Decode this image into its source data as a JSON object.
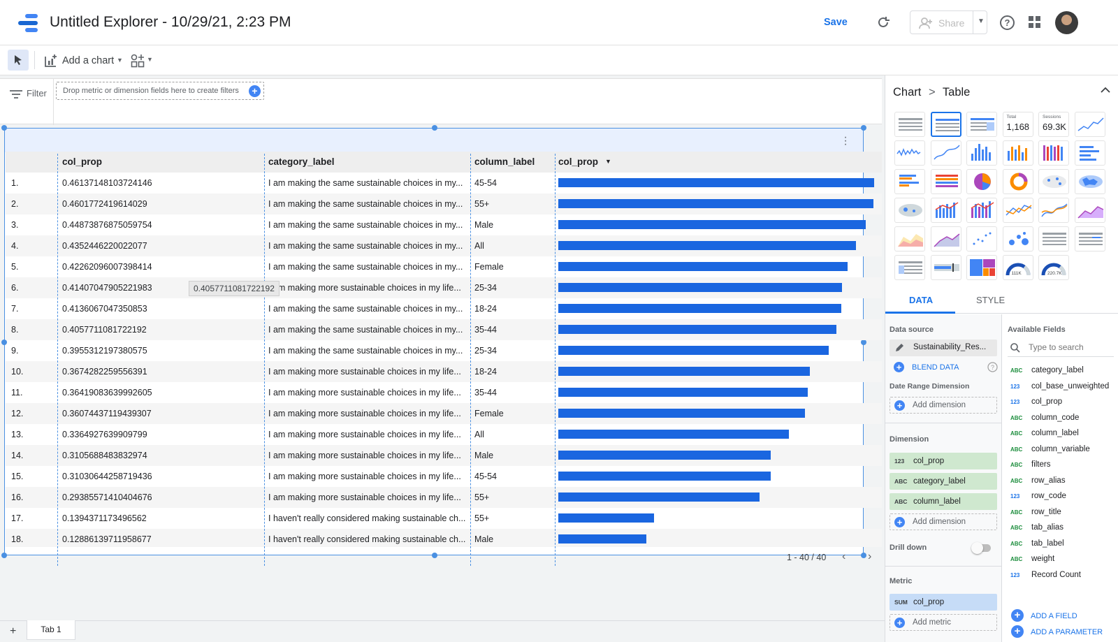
{
  "header": {
    "title": "Untitled Explorer - 10/29/21, 2:23 PM",
    "save_label": "Save",
    "share_label": "Share"
  },
  "toolbar": {
    "add_chart_label": "Add a chart"
  },
  "filter_bar": {
    "label": "Filter",
    "drop_hint": "Drop metric or dimension fields here to create filters"
  },
  "table": {
    "headers": [
      "col_prop",
      "category_label",
      "column_label",
      "col_prop"
    ],
    "sort_indicator": "▼",
    "rows": [
      {
        "n": "1.",
        "col_prop": "0.46137148103724146",
        "category_label": "I am making the same sustainable choices in my...",
        "column_label": "45-54",
        "bar": 0.46137148103724146
      },
      {
        "n": "2.",
        "col_prop": "0.4601772419614029",
        "category_label": "I am making the same sustainable choices in my...",
        "column_label": "55+",
        "bar": 0.4601772419614029
      },
      {
        "n": "3.",
        "col_prop": "0.44873876875059754",
        "category_label": "I am making the same sustainable choices in my...",
        "column_label": "Male",
        "bar": 0.44873876875059754
      },
      {
        "n": "4.",
        "col_prop": "0.4352446220022077",
        "category_label": "I am making the same sustainable choices in my...",
        "column_label": "All",
        "bar": 0.4352446220022077
      },
      {
        "n": "5.",
        "col_prop": "0.42262096007398414",
        "category_label": "I am making the same sustainable choices in my...",
        "column_label": "Female",
        "bar": 0.42262096007398414
      },
      {
        "n": "6.",
        "col_prop": "0.41407047905221983",
        "category_label": "I am making more sustainable choices in my life...",
        "column_label": "25-34",
        "bar": 0.41407047905221983
      },
      {
        "n": "7.",
        "col_prop": "0.4136067047350853",
        "category_label": "I am making the same sustainable choices in my...",
        "column_label": "18-24",
        "bar": 0.4136067047350853
      },
      {
        "n": "8.",
        "col_prop": "0.4057711081722192",
        "category_label": "I am making the same sustainable choices in my...",
        "column_label": "35-44",
        "bar": 0.4057711081722192
      },
      {
        "n": "9.",
        "col_prop": "0.3955312197380575",
        "category_label": "I am making the same sustainable choices in my...",
        "column_label": "25-34",
        "bar": 0.3955312197380575
      },
      {
        "n": "10.",
        "col_prop": "0.3674282259556391",
        "category_label": "I am making more sustainable choices in my life...",
        "column_label": "18-24",
        "bar": 0.3674282259556391
      },
      {
        "n": "11.",
        "col_prop": "0.36419083639992605",
        "category_label": "I am making more sustainable choices in my life...",
        "column_label": "35-44",
        "bar": 0.36419083639992605
      },
      {
        "n": "12.",
        "col_prop": "0.36074437119439307",
        "category_label": "I am making more sustainable choices in my life...",
        "column_label": "Female",
        "bar": 0.36074437119439307
      },
      {
        "n": "13.",
        "col_prop": "0.3364927639909799",
        "category_label": "I am making more sustainable choices in my life...",
        "column_label": "All",
        "bar": 0.3364927639909799
      },
      {
        "n": "14.",
        "col_prop": "0.3105688483832974",
        "category_label": "I am making more sustainable choices in my life...",
        "column_label": "Male",
        "bar": 0.3105688483832974
      },
      {
        "n": "15.",
        "col_prop": "0.31030644258719436",
        "category_label": "I am making more sustainable choices in my life...",
        "column_label": "45-54",
        "bar": 0.31030644258719436
      },
      {
        "n": "16.",
        "col_prop": "0.29385571410404676",
        "category_label": "I am making more sustainable choices in my life...",
        "column_label": "55+",
        "bar": 0.29385571410404676
      },
      {
        "n": "17.",
        "col_prop": "0.1394371173496562",
        "category_label": "I haven't really considered making sustainable ch...",
        "column_label": "55+",
        "bar": 0.1394371173496562
      },
      {
        "n": "18.",
        "col_prop": "0.12886139711958677",
        "category_label": "I haven't really considered making sustainable ch...",
        "column_label": "Male",
        "bar": 0.12886139711958677
      }
    ],
    "tooltip": "0.4057711081722192",
    "pagination": "1 - 40 / 40"
  },
  "tabs": {
    "tab1": "Tab 1",
    "add": "+"
  },
  "panel": {
    "breadcrumb_chart": "Chart",
    "breadcrumb_sep": ">",
    "breadcrumb_type": "Table",
    "thumb_total_label": "Total",
    "thumb_total_value": "1,168",
    "thumb_sessions_label": "Sessions",
    "thumb_sessions_value": "69.3K",
    "gauge1": "111K",
    "gauge2": "220.7K",
    "tab_data": "DATA",
    "tab_style": "STYLE",
    "data_source_label": "Data source",
    "data_source_name": "Sustainability_Res...",
    "blend_data": "BLEND DATA",
    "date_range_label": "Date Range Dimension",
    "add_dimension": "Add dimension",
    "dimension_label": "Dimension",
    "dimensions": [
      {
        "type": "123",
        "name": "col_prop"
      },
      {
        "type": "ABC",
        "name": "category_label"
      },
      {
        "type": "ABC",
        "name": "column_label"
      }
    ],
    "drill_down": "Drill down",
    "metric_label": "Metric",
    "metric": {
      "type": "SUM",
      "name": "col_prop"
    },
    "add_metric": "Add metric",
    "available_fields_label": "Available Fields",
    "search_placeholder": "Type to search",
    "fields": [
      {
        "type": "ABC",
        "name": "category_label"
      },
      {
        "type": "123",
        "name": "col_base_unweighted"
      },
      {
        "type": "123",
        "name": "col_prop"
      },
      {
        "type": "ABC",
        "name": "column_code"
      },
      {
        "type": "ABC",
        "name": "column_label"
      },
      {
        "type": "ABC",
        "name": "column_variable"
      },
      {
        "type": "ABC",
        "name": "filters"
      },
      {
        "type": "ABC",
        "name": "row_alias"
      },
      {
        "type": "123",
        "name": "row_code"
      },
      {
        "type": "ABC",
        "name": "row_title"
      },
      {
        "type": "ABC",
        "name": "tab_alias"
      },
      {
        "type": "ABC",
        "name": "tab_label"
      },
      {
        "type": "ABC",
        "name": "weight"
      },
      {
        "type": "123",
        "name": "Record Count"
      }
    ],
    "add_field": "ADD A FIELD",
    "add_parameter": "ADD A PARAMETER"
  },
  "colors": {
    "accent": "#1a73e8",
    "bar": "#1a66e0",
    "dimension_chip": "#cfe8cf",
    "metric_chip": "#c6dcf7"
  }
}
